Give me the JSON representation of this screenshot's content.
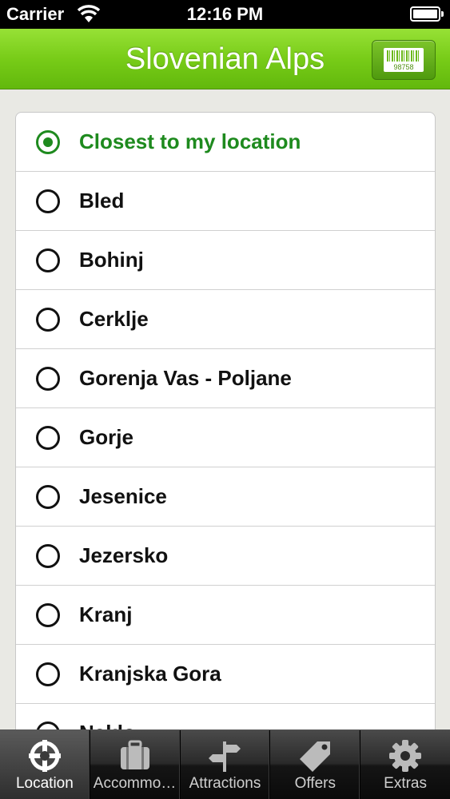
{
  "status_bar": {
    "carrier": "Carrier",
    "time": "12:16 PM"
  },
  "nav": {
    "title": "Slovenian Alps",
    "barcode_number": "98758"
  },
  "list": {
    "items": [
      {
        "label": "Closest to my location",
        "selected": true
      },
      {
        "label": "Bled",
        "selected": false
      },
      {
        "label": "Bohinj",
        "selected": false
      },
      {
        "label": "Cerklje",
        "selected": false
      },
      {
        "label": "Gorenja Vas - Poljane",
        "selected": false
      },
      {
        "label": "Gorje",
        "selected": false
      },
      {
        "label": "Jesenice",
        "selected": false
      },
      {
        "label": "Jezersko",
        "selected": false
      },
      {
        "label": "Kranj",
        "selected": false
      },
      {
        "label": "Kranjska Gora",
        "selected": false
      },
      {
        "label": "Naklo",
        "selected": false
      }
    ]
  },
  "tabs": [
    {
      "label": "Location",
      "icon": "crosshair-icon",
      "active": true
    },
    {
      "label": "Accommodation",
      "icon": "suitcase-icon",
      "active": false
    },
    {
      "label": "Attractions",
      "icon": "signpost-icon",
      "active": false
    },
    {
      "label": "Offers",
      "icon": "tag-icon",
      "active": false
    },
    {
      "label": "Extras",
      "icon": "gear-icon",
      "active": false
    }
  ],
  "colors": {
    "accent": "#78cc18",
    "selected": "#1e8a1e"
  }
}
